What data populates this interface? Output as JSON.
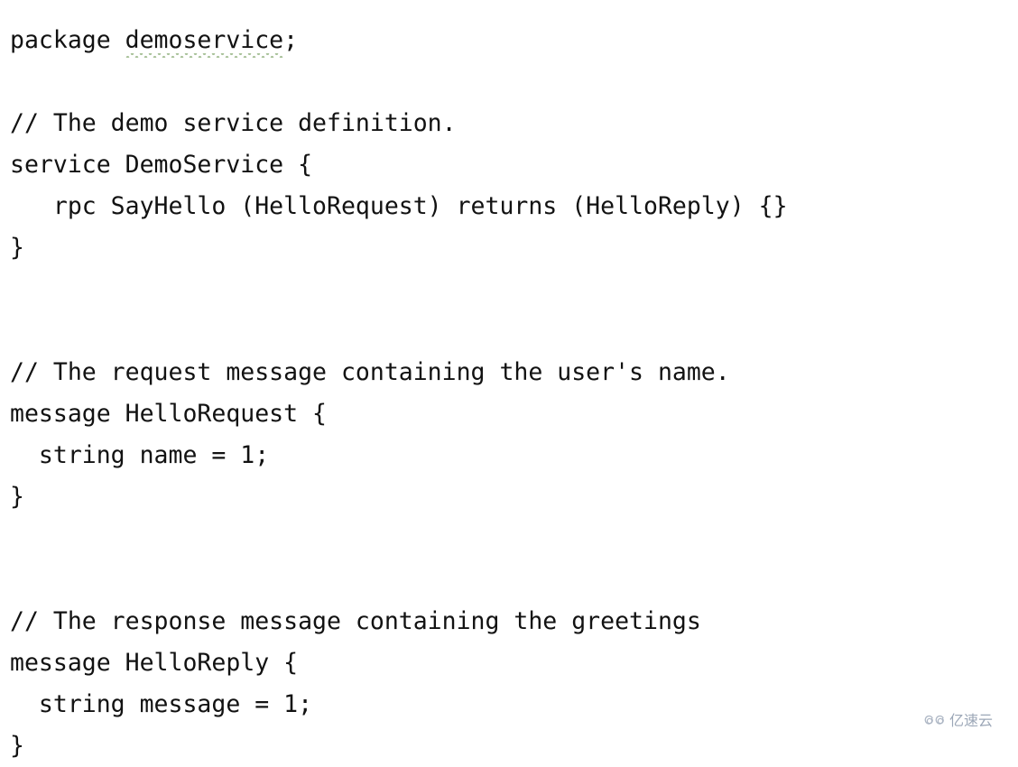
{
  "document": {
    "language": "protobuf",
    "background_color": "#ffffff",
    "text_color": "#121212",
    "spellcheck_underline_color": "#a9c29a",
    "lines": [
      {
        "text": "package demoservice;",
        "blank": false,
        "spellcheck_token": "demoservice",
        "prefix": "package ",
        "suffix": ";"
      },
      {
        "text": "",
        "blank": true
      },
      {
        "text": "// The demo service definition.",
        "blank": false
      },
      {
        "text": "service DemoService {",
        "blank": false
      },
      {
        "text": "   rpc SayHello (HelloRequest) returns (HelloReply) {}",
        "blank": false
      },
      {
        "text": "}",
        "blank": false
      },
      {
        "text": "",
        "blank": true
      },
      {
        "text": "",
        "blank": true
      },
      {
        "text": "// The request message containing the user's name.",
        "blank": false
      },
      {
        "text": "message HelloRequest {",
        "blank": false
      },
      {
        "text": "  string name = 1;",
        "blank": false
      },
      {
        "text": "}",
        "blank": false
      },
      {
        "text": "",
        "blank": true
      },
      {
        "text": "",
        "blank": true
      },
      {
        "text": "// The response message containing the greetings",
        "blank": false
      },
      {
        "text": "message HelloReply {",
        "blank": false
      },
      {
        "text": "  string message = 1;",
        "blank": false
      },
      {
        "text": "}",
        "blank": false
      }
    ]
  },
  "watermark": {
    "text": "亿速云",
    "icon": "cloud-logo-icon",
    "color": "#97a3b4"
  }
}
